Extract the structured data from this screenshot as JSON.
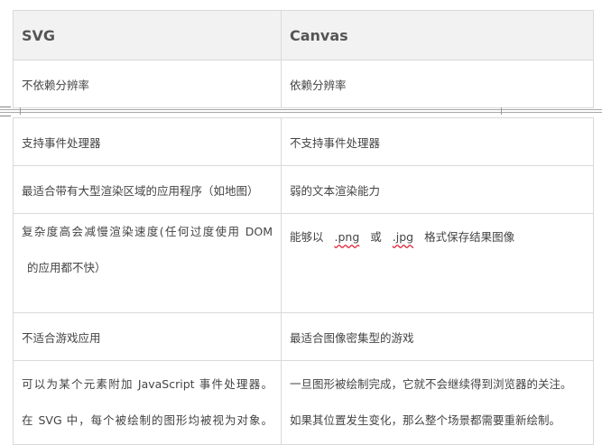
{
  "header": {
    "col1": "SVG",
    "col2": "Canvas"
  },
  "rows": [
    {
      "svg": "不依赖分辨率",
      "canvas": "依赖分辨率"
    },
    {
      "svg": "支持事件处理器",
      "canvas": "不支持事件处理器"
    },
    {
      "svg": "最适合带有大型渲染区域的应用程序（如地图）",
      "canvas": "弱的文本渲染能力"
    },
    {
      "svg_line1": "复杂度高会减慢渲染速度(任何过度使用 DOM",
      "svg_line2": "的应用都不快）",
      "canvas_pre": "能够以",
      "canvas_png": ".png",
      "canvas_or": "或",
      "canvas_jpg": ".jpg",
      "canvas_post": "格式保存结果图像"
    },
    {
      "svg": "不适合游戏应用",
      "canvas": "最适合图像密集型的游戏"
    },
    {
      "svg_line1": "可以为某个元素附加 JavaScript 事件处理器。",
      "svg_line2": "在 SVG 中，每个被绘制的图形均被视为对象。",
      "canvas_line1": "一旦图形被绘制完成，它就不会继续得到浏览器的关注。",
      "canvas_line2": "如果其位置发生变化，那么整个场景都需要重新绘制。"
    }
  ]
}
